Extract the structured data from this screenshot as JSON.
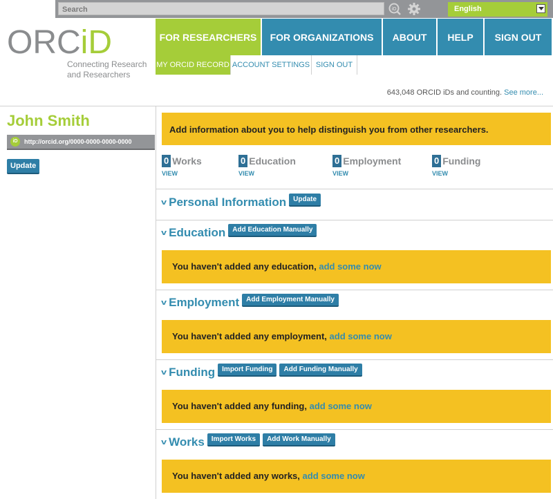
{
  "search": {
    "placeholder": "Search"
  },
  "language": {
    "selected": "English"
  },
  "logo": {
    "orc": "ORC",
    "id": "iD",
    "tagline": "Connecting Research and Researchers"
  },
  "nav": {
    "items": [
      "FOR RESEARCHERS",
      "FOR ORGANIZATIONS",
      "ABOUT",
      "HELP",
      "SIGN OUT"
    ],
    "sub_items": [
      "MY ORCID RECORD",
      "ACCOUNT SETTINGS",
      "SIGN OUT"
    ]
  },
  "counter": {
    "text": "643,048 ORCID iDs and counting.",
    "link": "See more..."
  },
  "profile": {
    "name": "John Smith",
    "badge": "iD",
    "orcid_url": "http://orcid.org/0000-0000-0000-0000",
    "update_label": "Update"
  },
  "intro": {
    "text": "Add information about you to help distinguish you from other researchers."
  },
  "stats": [
    {
      "count": "0",
      "label": "Works",
      "view": "VIEW"
    },
    {
      "count": "0",
      "label": "Education",
      "view": "VIEW"
    },
    {
      "count": "0",
      "label": "Employment",
      "view": "VIEW"
    },
    {
      "count": "0",
      "label": "Funding",
      "view": "VIEW"
    }
  ],
  "sections": {
    "personal": {
      "title": "Personal Information",
      "button": "Update"
    },
    "education": {
      "title": "Education",
      "button": "Add Education Manually",
      "empty": "You haven't added any education,",
      "link": "add some now"
    },
    "employment": {
      "title": "Employment",
      "button": "Add Employment Manually",
      "empty": "You haven't added any employment,",
      "link": "add some now"
    },
    "funding": {
      "title": "Funding",
      "button_import": "Import Funding",
      "button": "Add Funding Manually",
      "empty": "You haven't added any funding,",
      "link": "add some now"
    },
    "works": {
      "title": "Works",
      "button_import": "Import Works",
      "button": "Add Work Manually",
      "empty": "You haven't added any works,",
      "link": "add some now"
    }
  },
  "colors": {
    "green": "#a5cd39",
    "blue": "#338caf",
    "yellow": "#f4c122",
    "gray": "#939598"
  }
}
